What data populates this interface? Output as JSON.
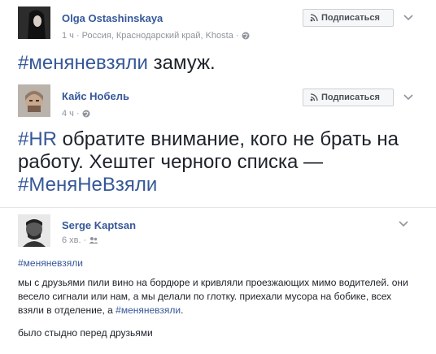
{
  "posts": [
    {
      "author": "Olga Ostashinskaya",
      "meta": "1 ч · Россия, Краснодарский край, Khosta",
      "subscribe_label": "Подписаться",
      "text_hashtag": "#меняневзяли",
      "text_rest": " замуж."
    },
    {
      "author": "Кайс Нобель",
      "meta": "4 ч",
      "subscribe_label": "Подписаться",
      "text_hashtag1": "#HR",
      "text_mid": " обратите внимание, кого не брать на работу. Хештег черного списка — ",
      "text_hashtag2": "#МеняНеВзяли"
    },
    {
      "author": "Serge Kaptsan",
      "meta": "6 хв.",
      "hashtag_line": "#меняневзяли",
      "para1_a": "мы с друзьями пили вино на бордюре и кривляли проезжающих мимо водителей. они весело сигнали или нам, а мы делали по глотку. приехали мусора на бобике, всех взяли в отделение, а ",
      "para1_tag": "#меняневзяли",
      "para1_b": ".",
      "para2": "было стыдно перед друзьями"
    }
  ],
  "icons": {
    "globe": "globe-icon",
    "rss": "rss-icon",
    "chevron": "chevron-down-icon",
    "friends": "friends-icon"
  },
  "colors": {
    "link": "#365899",
    "meta": "#90949c",
    "text": "#1d2129",
    "button_bg": "#f6f7f9",
    "button_border": "#ced0d4"
  }
}
